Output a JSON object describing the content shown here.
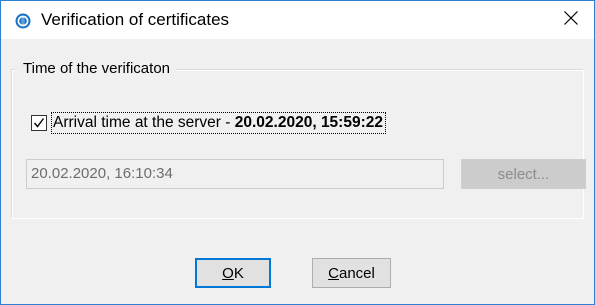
{
  "window": {
    "title": "Verification of certificates"
  },
  "group": {
    "label": "Time of the verificaton"
  },
  "arrival": {
    "checked": true,
    "label_prefix": "Arrival time at the server - ",
    "label_value": "20.02.2020, 15:59:22"
  },
  "custom_time": {
    "value": "20.02.2020, 16:10:34",
    "select_label": "select..."
  },
  "buttons": {
    "ok_mnemonic": "O",
    "ok_rest": "K",
    "cancel_mnemonic": "C",
    "cancel_rest": "ancel"
  },
  "colors": {
    "accent": "#0078d7",
    "border": "#2f7fd3",
    "client_bg": "#f0f0f0"
  },
  "icons": {
    "app": "app-logo-icon",
    "close": "close-icon",
    "check": "checkmark-icon"
  }
}
